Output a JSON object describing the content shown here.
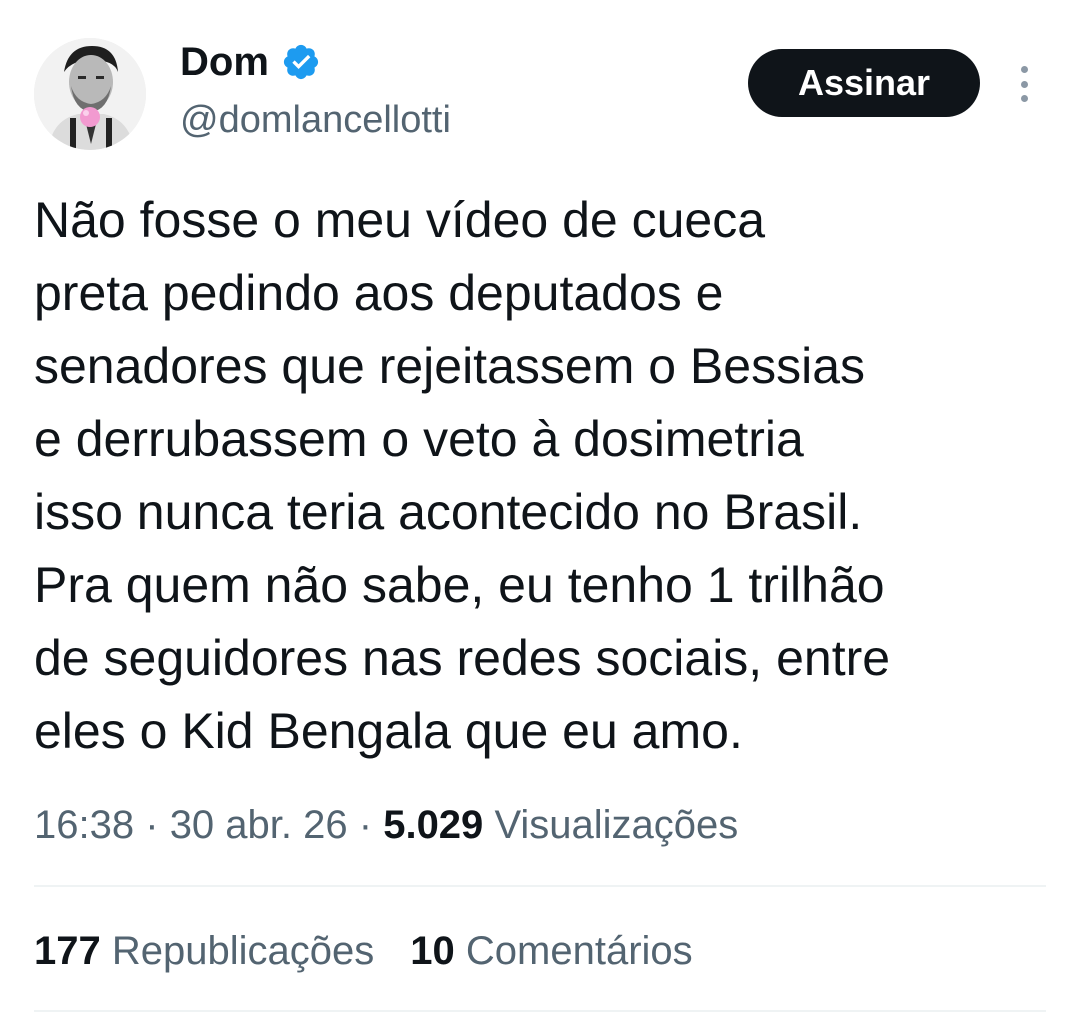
{
  "tweet": {
    "author": {
      "display_name": "Dom",
      "handle": "@domlancellotti",
      "verified": true,
      "verified_color": "#1d9bf0"
    },
    "subscribe_label": "Assinar",
    "text_lines": [
      "Não fosse o meu vídeo de cueca",
      "preta pedindo aos deputados e",
      "senadores que rejeitassem o Bessias",
      "e derrubassem o veto à dosimetria",
      "isso nunca teria acontecido no Brasil.",
      "Pra quem não sabe, eu tenho 1 trilhão",
      "de seguidores nas redes sociais, entre",
      "eles o Kid Bengala que eu amo."
    ],
    "time": "16:38",
    "date": "30 abr. 26",
    "separator": "·",
    "views_count": "5.029",
    "views_label": "Visualizações",
    "stats": {
      "reposts_count": "177",
      "reposts_label": "Republicações",
      "comments_count": "10",
      "comments_label": "Comentários"
    }
  },
  "colors": {
    "text_primary": "#0f1419",
    "text_secondary": "#536471",
    "button_bg": "#0f1419",
    "divider": "#eff3f4"
  },
  "icons": {
    "verified": "verified-badge-icon",
    "more": "more-vertical-icon"
  }
}
